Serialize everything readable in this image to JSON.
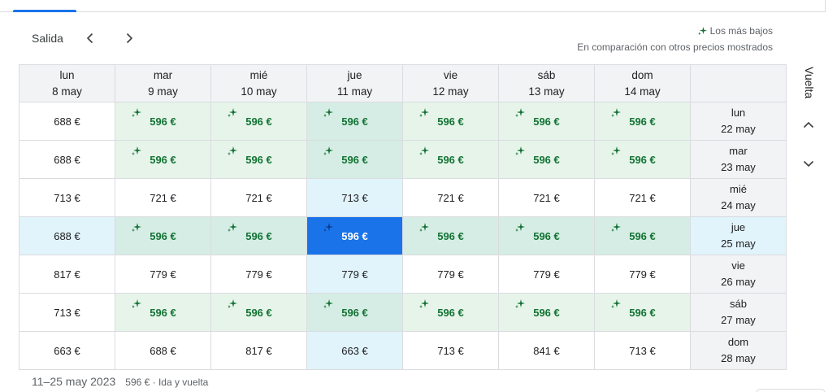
{
  "nav": {
    "label": "Salida",
    "prev_icon": "chevron-left-icon",
    "next_icon": "chevron-right-icon"
  },
  "legend": {
    "lowest_label": "Los más bajos",
    "comparison_text": "En comparación con otros precios mostrados",
    "icon": "sparkle-icon"
  },
  "side_label": "Vuelta",
  "colors": {
    "low_bg": "#e6f4ea",
    "low_text": "#137333",
    "selected_bg": "#1a73e8",
    "highlight_bg": "#e1f3fb",
    "header_bg": "#f1f3f4"
  },
  "departure_days": [
    {
      "dow": "lun",
      "date": "8 may"
    },
    {
      "dow": "mar",
      "date": "9 may"
    },
    {
      "dow": "mié",
      "date": "10 may"
    },
    {
      "dow": "jue",
      "date": "11 may"
    },
    {
      "dow": "vie",
      "date": "12 may"
    },
    {
      "dow": "sáb",
      "date": "13 may"
    },
    {
      "dow": "dom",
      "date": "14 may"
    }
  ],
  "return_days": [
    {
      "dow": "lun",
      "date": "22 may"
    },
    {
      "dow": "mar",
      "date": "23 may"
    },
    {
      "dow": "mié",
      "date": "24 may"
    },
    {
      "dow": "jue",
      "date": "25 may"
    },
    {
      "dow": "vie",
      "date": "26 may"
    },
    {
      "dow": "sáb",
      "date": "27 may"
    },
    {
      "dow": "dom",
      "date": "28 may"
    }
  ],
  "selected": {
    "row": 3,
    "col": 3
  },
  "rows": [
    {
      "cells": [
        {
          "price": "688 €",
          "low": false
        },
        {
          "price": "596 €",
          "low": true
        },
        {
          "price": "596 €",
          "low": true
        },
        {
          "price": "596 €",
          "low": true
        },
        {
          "price": "596 €",
          "low": true
        },
        {
          "price": "596 €",
          "low": true
        },
        {
          "price": "596 €",
          "low": true
        }
      ]
    },
    {
      "cells": [
        {
          "price": "688 €",
          "low": false
        },
        {
          "price": "596 €",
          "low": true
        },
        {
          "price": "596 €",
          "low": true
        },
        {
          "price": "596 €",
          "low": true
        },
        {
          "price": "596 €",
          "low": true
        },
        {
          "price": "596 €",
          "low": true
        },
        {
          "price": "596 €",
          "low": true
        }
      ]
    },
    {
      "cells": [
        {
          "price": "713 €",
          "low": false
        },
        {
          "price": "721 €",
          "low": false
        },
        {
          "price": "721 €",
          "low": false
        },
        {
          "price": "713 €",
          "low": false
        },
        {
          "price": "721 €",
          "low": false
        },
        {
          "price": "721 €",
          "low": false
        },
        {
          "price": "721 €",
          "low": false
        }
      ]
    },
    {
      "cells": [
        {
          "price": "688 €",
          "low": false
        },
        {
          "price": "596 €",
          "low": true
        },
        {
          "price": "596 €",
          "low": true
        },
        {
          "price": "596 €",
          "low": true
        },
        {
          "price": "596 €",
          "low": true
        },
        {
          "price": "596 €",
          "low": true
        },
        {
          "price": "596 €",
          "low": true
        }
      ]
    },
    {
      "cells": [
        {
          "price": "817 €",
          "low": false
        },
        {
          "price": "779 €",
          "low": false
        },
        {
          "price": "779 €",
          "low": false
        },
        {
          "price": "779 €",
          "low": false
        },
        {
          "price": "779 €",
          "low": false
        },
        {
          "price": "779 €",
          "low": false
        },
        {
          "price": "779 €",
          "low": false
        }
      ]
    },
    {
      "cells": [
        {
          "price": "713 €",
          "low": false
        },
        {
          "price": "596 €",
          "low": true
        },
        {
          "price": "596 €",
          "low": true
        },
        {
          "price": "596 €",
          "low": true
        },
        {
          "price": "596 €",
          "low": true
        },
        {
          "price": "596 €",
          "low": true
        },
        {
          "price": "596 €",
          "low": true
        }
      ]
    },
    {
      "cells": [
        {
          "price": "663 €",
          "low": false
        },
        {
          "price": "688 €",
          "low": false
        },
        {
          "price": "817 €",
          "low": false
        },
        {
          "price": "663 €",
          "low": false
        },
        {
          "price": "713 €",
          "low": false
        },
        {
          "price": "841 €",
          "low": false
        },
        {
          "price": "713 €",
          "low": false
        }
      ]
    }
  ],
  "footer": {
    "dates": "11–25 may 2023",
    "summary": "596 € · Ida y vuelta"
  }
}
